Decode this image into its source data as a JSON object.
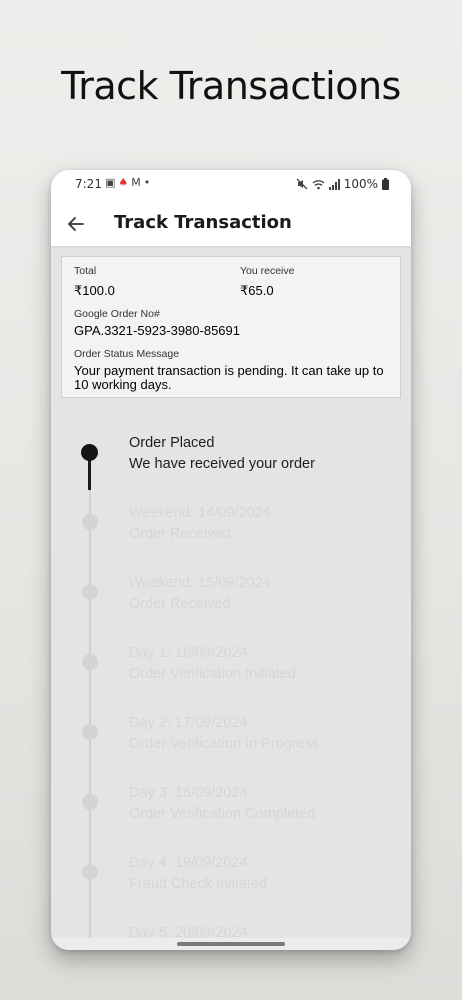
{
  "promo": {
    "title": "Track Transactions"
  },
  "status_bar": {
    "time": "7:21",
    "left_icons": [
      "image-icon",
      "spade-icon",
      "gmail-icon",
      "dot-icon"
    ],
    "battery": "100%"
  },
  "app_bar": {
    "title": "Track Transaction"
  },
  "summary": {
    "total_label": "Total",
    "total_value": "₹100.0",
    "receive_label": "You receive",
    "receive_value": "₹65.0",
    "order_no_label": "Google Order No#",
    "order_no_value": "GPA.3321-5923-3980-85691",
    "status_label": "Order Status Message",
    "status_message": "Your payment transaction is pending. It can take up to 10 working days."
  },
  "timeline": {
    "steps": [
      {
        "title": "Order Placed",
        "subtitle": "We have received your order",
        "active": true
      },
      {
        "title": "Weekend: 14/09/2024",
        "subtitle": "Order Received",
        "active": false
      },
      {
        "title": "Weekend: 15/09/2024",
        "subtitle": "Order Received",
        "active": false
      },
      {
        "title": "Day 1: 16/09/2024",
        "subtitle": "Order Verification Initiated",
        "active": false
      },
      {
        "title": "Day 2: 17/09/2024",
        "subtitle": "Order Verification In Progress",
        "active": false
      },
      {
        "title": "Day 3: 18/09/2024",
        "subtitle": "Order Verification Completed",
        "active": false
      },
      {
        "title": "Day 4: 19/09/2024",
        "subtitle": "Fraud Check Initiated",
        "active": false
      },
      {
        "title": "Day 5: 20/09/2024",
        "subtitle": "",
        "active": false
      }
    ]
  }
}
